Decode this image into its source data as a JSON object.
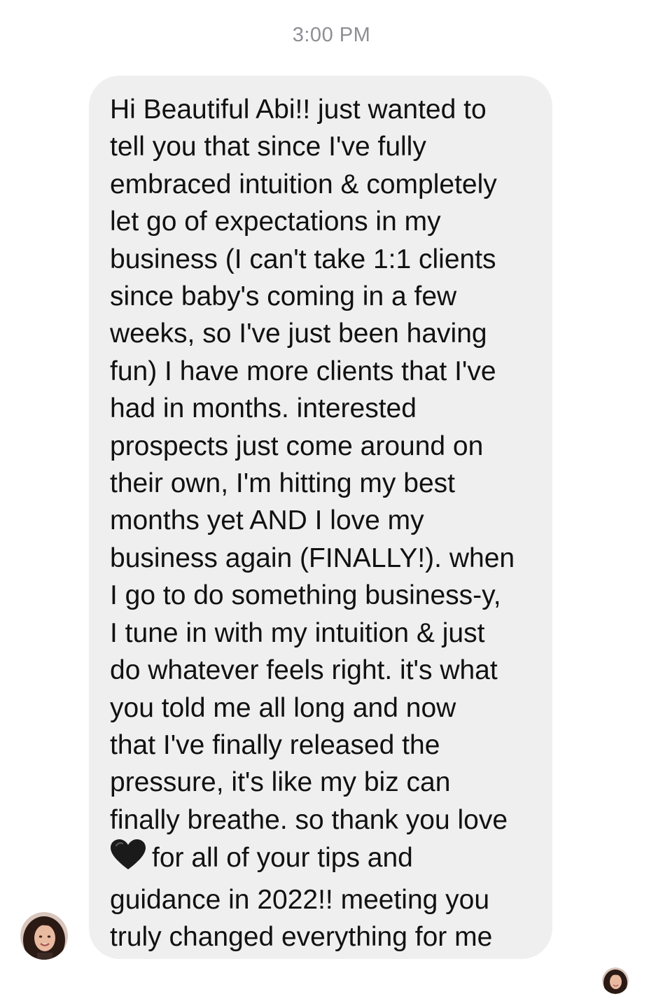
{
  "thread": {
    "timestamp": "3:00 PM"
  },
  "message": {
    "lines_before_heart": [
      "Hi Beautiful Abi!! just wanted to",
      "tell you that since I've fully",
      "embraced intuition & completely",
      "let go of expectations in my",
      "business (I can't take 1:1 clients",
      "since baby's coming in a few",
      "weeks, so I've just been having",
      "fun) I have more clients that I've",
      "had in months. interested",
      "prospects just come around on",
      "their own, I'm hitting my best",
      "months yet AND I love my",
      "business again (FINALLY!). when",
      "I go to do something business-y,",
      "I tune in with my intuition & just",
      "do whatever feels right. it's what",
      "you told me all long and now",
      "that I've finally released the",
      "pressure, it's like my biz can",
      "finally breathe. so thank you love"
    ],
    "heart_line_text": "for all of your tips and",
    "lines_after_heart": [
      "guidance in 2022!! meeting you",
      "truly changed everything for me"
    ],
    "heart_icon": "black-heart-icon",
    "bubble_color": "#efefef",
    "text_color": "#111111"
  },
  "avatars": {
    "sender": "sender-avatar",
    "read_receipt": "read-receipt-avatar"
  }
}
